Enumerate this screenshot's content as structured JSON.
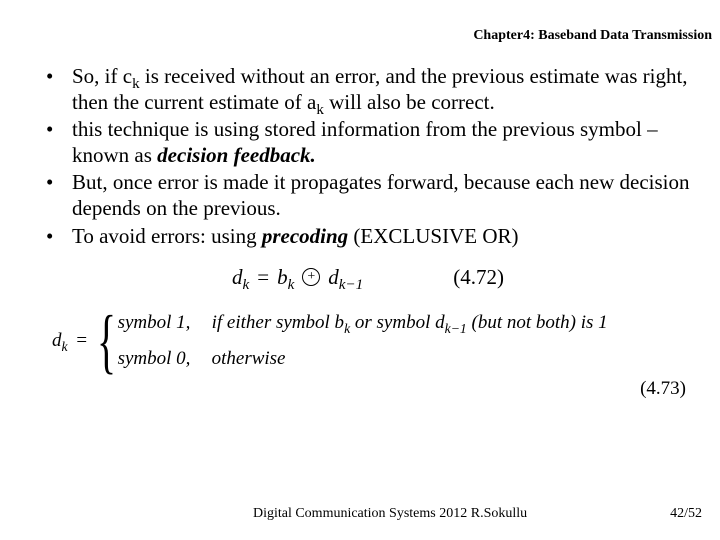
{
  "header": {
    "chapter": "Chapter4: Baseband Data Transmission"
  },
  "bullets": [
    {
      "pre": "So, if c",
      "sub1": "k",
      "mid": " is received without an error, and the previous estimate was right, then the current estimate of a",
      "sub2": "k",
      "post": " will also be correct."
    },
    {
      "pre": "this technique is using stored information from the previous symbol – known as ",
      "emph": "decision feedback.",
      "post": ""
    },
    {
      "pre": "But, once error is made it propagates forward, because each new decision depends on the previous.",
      "emph": "",
      "post": ""
    },
    {
      "pre": "To avoid errors: using ",
      "emph": "precoding",
      "post": " (EXCLUSIVE OR)"
    }
  ],
  "eq1": {
    "d": "d",
    "k": "k",
    "eq": "=",
    "b": "b",
    "op": "+",
    "d2": "d",
    "km1": "k−1",
    "label": "(4.72)"
  },
  "eq2": {
    "lhs_d": "d",
    "lhs_k": "k",
    "lhs_eq": "=",
    "row1_left": "symbol 1,",
    "row1_right_a": "if either symbol b",
    "row1_right_b": " or symbol d",
    "row1_right_c": " (but not both) is 1",
    "row2_left": "symbol 0,",
    "row2_right": "otherwise",
    "label": "(4.73)"
  },
  "footer": {
    "center": "Digital Communication Systems 2012 R.Sokullu",
    "page": "42/52"
  }
}
